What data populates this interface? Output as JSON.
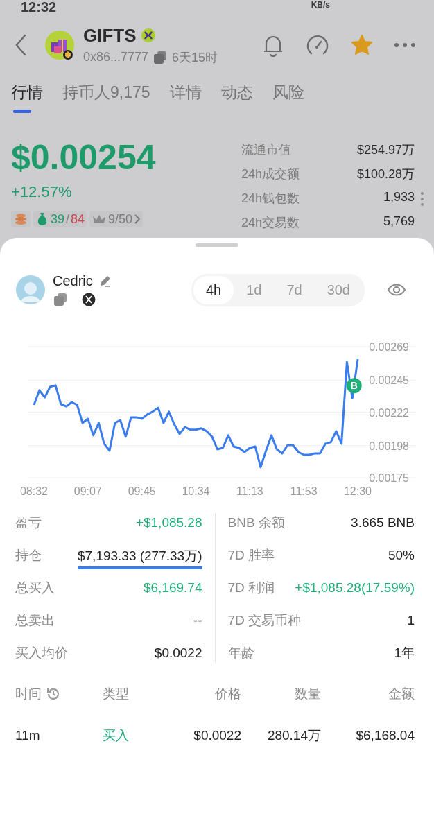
{
  "status_bar": {
    "time": "12:32",
    "speed": "KB/s"
  },
  "header": {
    "title": "GIFTS",
    "address": "0x86...7777",
    "age": "6天15时",
    "favorite": true
  },
  "tabs": [
    {
      "label": "行情",
      "selected": true
    },
    {
      "label": "持币人9,175",
      "selected": false
    },
    {
      "label": "详情",
      "selected": false
    },
    {
      "label": "动态",
      "selected": false
    },
    {
      "label": "风险",
      "selected": false
    }
  ],
  "price": {
    "value": "$0.00254",
    "change": "+12.57%",
    "wins": "39",
    "separator": "/",
    "losses": "84",
    "rank": "9/50"
  },
  "market_stats": [
    {
      "label": "流通市值",
      "value": "$254.97万"
    },
    {
      "label": "24h成交额",
      "value": "$100.28万"
    },
    {
      "label": "24h钱包数",
      "value": "1,933"
    },
    {
      "label": "24h交易数",
      "value": "5,769"
    }
  ],
  "trader": {
    "name": "Cedric"
  },
  "timeframes": [
    {
      "label": "4h",
      "selected": true
    },
    {
      "label": "1d",
      "selected": false
    },
    {
      "label": "7d",
      "selected": false
    },
    {
      "label": "30d",
      "selected": false
    }
  ],
  "chart_data": {
    "type": "line",
    "categories": [
      "08:32",
      null,
      null,
      null,
      null,
      null,
      null,
      null,
      null,
      null,
      "09:07",
      null,
      null,
      null,
      null,
      null,
      null,
      null,
      null,
      null,
      "09:45",
      null,
      null,
      null,
      null,
      null,
      null,
      null,
      null,
      null,
      "10:34",
      null,
      null,
      null,
      null,
      null,
      null,
      null,
      null,
      null,
      "11:13",
      null,
      null,
      null,
      null,
      null,
      null,
      null,
      null,
      null,
      "11:53",
      null,
      null,
      null,
      null,
      null,
      null,
      null,
      null,
      null,
      "12:30"
    ],
    "series": [
      {
        "color": "#3b7ded",
        "values": [
          0.002272,
          0.002377,
          0.002327,
          0.002402,
          0.002412,
          0.002277,
          0.002262,
          0.002292,
          0.002272,
          0.002143,
          0.002173,
          0.002054,
          0.002143,
          0.001994,
          0.001944,
          0.002143,
          0.002163,
          0.002044,
          0.002183,
          0.002183,
          0.002173,
          0.002203,
          0.002223,
          0.002252,
          0.002143,
          0.002223,
          0.002133,
          0.002064,
          0.002113,
          0.002094,
          0.002094,
          0.002104,
          0.002084,
          0.002044,
          0.001954,
          0.001964,
          0.002054,
          0.001974,
          0.001964,
          0.001934,
          0.001964,
          0.001974,
          0.001825,
          0.001944,
          0.002054,
          0.001954,
          0.001924,
          0.001984,
          0.001984,
          0.001934,
          0.001914,
          0.001914,
          0.001924,
          0.001924,
          0.001994,
          0.002004,
          0.002084,
          0.001994,
          0.00258,
          0.00232,
          0.0026
        ]
      }
    ],
    "ylim": [
      0.00175,
      0.00269
    ],
    "yticks": [
      0.00269,
      0.00245,
      0.00222,
      0.00198,
      0.00175
    ],
    "grid": true,
    "annotations": [
      {
        "y": 0.00241,
        "text": "B"
      }
    ]
  },
  "pnl_stats": [
    {
      "label": "盈亏",
      "value": "+$1,085.28",
      "positive": true,
      "underlined": false
    },
    {
      "label": "持仓",
      "value": "$7,193.33 (277.33万)",
      "positive": false,
      "underlined": true
    },
    {
      "label": "总买入",
      "value": "$6,169.74",
      "positive": true,
      "underlined": false
    },
    {
      "label": "总卖出",
      "value": "--",
      "positive": false,
      "underlined": false
    },
    {
      "label": "买入均价",
      "value": "$0.0022",
      "positive": false,
      "underlined": false
    }
  ],
  "wallet_stats": [
    {
      "label": "BNB 余额",
      "value": "3.665 BNB",
      "positive": false
    },
    {
      "label": "7D 胜率",
      "value": "50%",
      "positive": false
    },
    {
      "label": "7D 利润",
      "value": "+$1,085.28(17.59%)",
      "positive": true
    },
    {
      "label": "7D 交易币种",
      "value": "1",
      "positive": false
    },
    {
      "label": "年龄",
      "value": "1年",
      "positive": false
    }
  ],
  "trades": {
    "columns": [
      "时间",
      "类型",
      "价格",
      "数量",
      "金额"
    ],
    "rows": [
      {
        "time": "11m",
        "type": "买入",
        "positive": true,
        "price": "$0.0022",
        "amount": "280.14万",
        "total": "$6,168.04"
      }
    ]
  }
}
